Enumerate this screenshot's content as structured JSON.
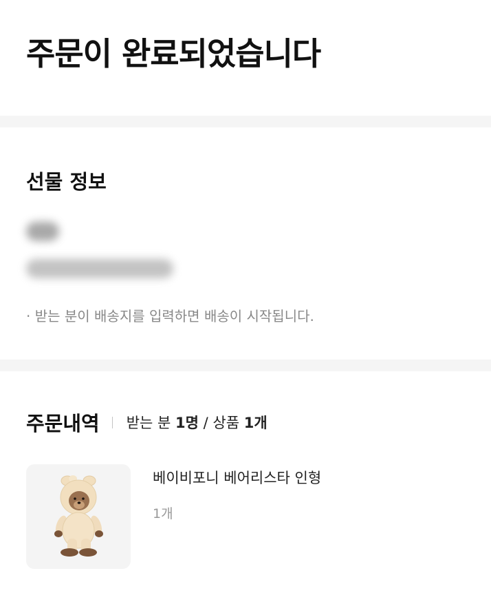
{
  "header": {
    "title": "주문이 완료되었습니다"
  },
  "gift_info": {
    "section_title": "선물 정보",
    "notice": "· 받는 분이 배송지를 입력하면 배송이 시작됩니다."
  },
  "order_history": {
    "section_title": "주문내역",
    "recipient_prefix": "받는 분 ",
    "recipient_count": "1명",
    "slash": " / ",
    "product_prefix": "상품 ",
    "product_count": "1개",
    "items": [
      {
        "name": "베이비포니 베어리스타 인형",
        "quantity": "1개",
        "image_icon": "bear-plush-doll-image"
      }
    ]
  },
  "colors": {
    "background": "#ffffff",
    "divider": "#f5f5f5",
    "text_primary": "#111111",
    "text_muted": "#888888"
  }
}
